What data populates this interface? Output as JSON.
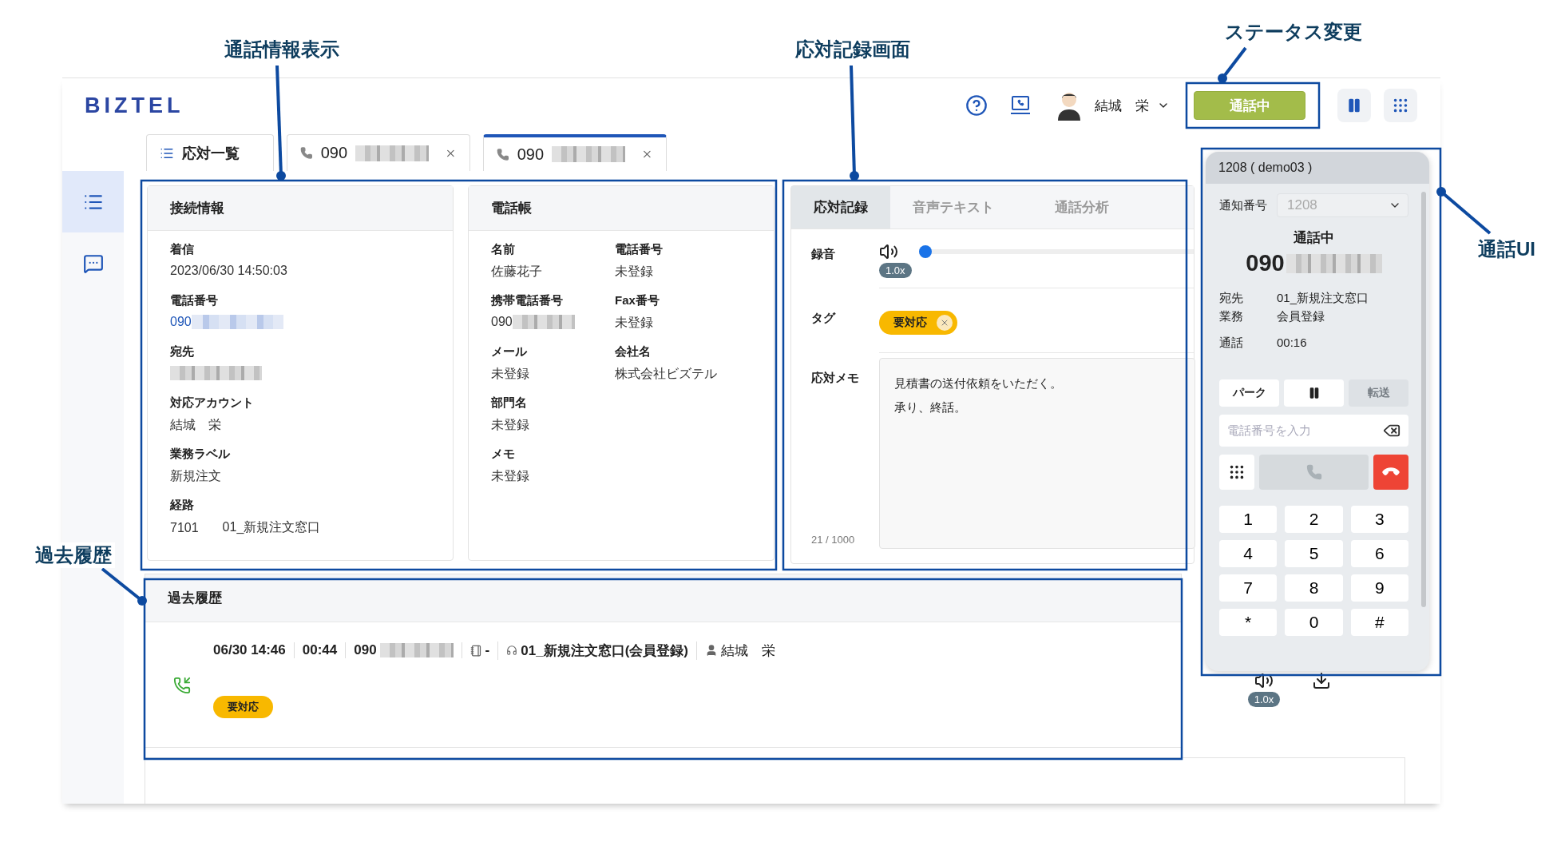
{
  "annotations": [
    {
      "label": "通話情報表示"
    },
    {
      "label": "応対記録画面"
    },
    {
      "label": "ステータス変更"
    },
    {
      "label": "通話UI"
    },
    {
      "label": "過去履歴"
    }
  ],
  "header": {
    "logo": "BIZTEL",
    "user_name": "結城　栄",
    "status_button": "通話中"
  },
  "tabs": [
    {
      "kind": "list",
      "label": "応対一覧",
      "selected": false
    },
    {
      "kind": "call",
      "label": "090",
      "redacted": true,
      "selected": false
    },
    {
      "kind": "call",
      "label": "090",
      "redacted": true,
      "selected": true
    }
  ],
  "sidebar": {
    "items": [
      {
        "kind": "list",
        "selected": true
      },
      {
        "kind": "chat",
        "selected": false
      }
    ]
  },
  "connection_info": {
    "title": "接続情報",
    "fields": [
      {
        "label": "着信",
        "values": [
          "2023/06/30 14:50:03"
        ]
      },
      {
        "label": "電話番号",
        "values": [
          "090"
        ],
        "redacted": true,
        "link": true
      },
      {
        "label": "宛先",
        "redacted": true
      },
      {
        "label": "対応アカウント",
        "values": [
          "結城　栄"
        ]
      },
      {
        "label": "業務ラベル",
        "values": [
          "新規注文"
        ]
      },
      {
        "label": "経路",
        "values": [
          "7101",
          "01_新規注文窓口"
        ]
      }
    ]
  },
  "phonebook": {
    "title": "電話帳",
    "rows": [
      [
        {
          "label": "名前",
          "value": "佐藤花子"
        },
        {
          "label": "電話番号",
          "value": "未登録"
        }
      ],
      [
        {
          "label": "携帯電話番号",
          "value": "090",
          "redacted": true
        },
        {
          "label": "Fax番号",
          "value": "未登録"
        }
      ],
      [
        {
          "label": "メール",
          "value": "未登録"
        },
        {
          "label": "会社名",
          "value": "株式会社ビズテル"
        }
      ],
      [
        {
          "label": "部門名",
          "value": "未登録"
        }
      ],
      [
        {
          "label": "メモ",
          "value": "未登録"
        }
      ]
    ]
  },
  "record": {
    "tabs": [
      {
        "label": "応対記録",
        "selected": true
      },
      {
        "label": "音声テキスト",
        "selected": false
      },
      {
        "label": "通話分析",
        "selected": false
      }
    ],
    "recording_label": "録音",
    "playback": {
      "level": 0,
      "speed": "1.0x"
    },
    "tag_label": "タグ",
    "tags": [
      {
        "label": "要対応",
        "color": "#f8b800"
      }
    ],
    "memo_label": "応対メモ",
    "memo_lines": [
      "見積書の送付依頼をいただく。",
      "承り、終話。"
    ],
    "counter": "21 / 1000"
  },
  "history": {
    "title": "過去履歴",
    "entries": [
      {
        "date": "06/30 14:46",
        "duration": "00:44",
        "number": "090",
        "phonebook": "-",
        "route": "01_新規注文窓口(会員登録)",
        "agent": "結城　栄",
        "tags": [
          {
            "label": "要対応",
            "color": "#f8b800"
          }
        ]
      }
    ]
  },
  "side_player": {
    "speed": "1.0x"
  },
  "call_panel": {
    "title": "1208 ( demo03 )",
    "caller_id_label": "通知番号",
    "caller_id": "1208",
    "status": "通話中",
    "number": "090",
    "details": [
      {
        "label": "宛先",
        "value": "01_新規注文窓口"
      },
      {
        "label": "業務",
        "value": "会員登録"
      },
      {
        "label": "通話",
        "value": "00:16"
      }
    ],
    "actions": [
      {
        "kind": "park",
        "label": "パーク",
        "disabled": false
      },
      {
        "kind": "hold",
        "disabled": false
      },
      {
        "kind": "transfer",
        "label": "転送",
        "disabled": true
      }
    ],
    "dial_placeholder": "電話番号を入力",
    "call_disabled": true,
    "keys": [
      "1",
      "2",
      "3",
      "4",
      "5",
      "6",
      "7",
      "8",
      "9",
      "*",
      "0",
      "#"
    ]
  }
}
